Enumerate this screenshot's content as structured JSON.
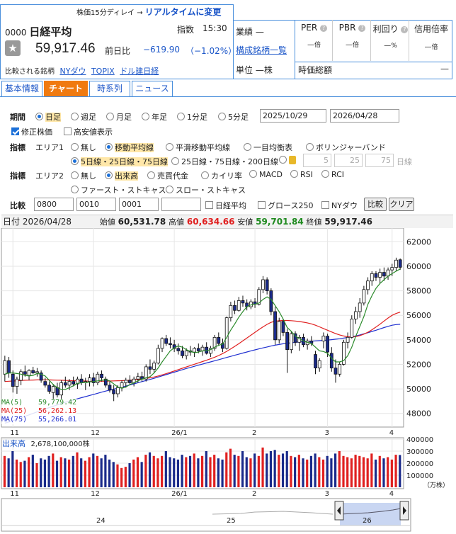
{
  "quote": {
    "delay_note": "株価15分ディレイ →",
    "realtime_link": "リアルタイムに変更",
    "code": "0000",
    "name": "日経平均",
    "type_label": "指数",
    "time": "15:30",
    "price": "59,917.46",
    "change_label": "前日比",
    "change": "−619.90",
    "change_pct": "（−1.02%）",
    "compare_label": "比較される銘柄",
    "compare_links": [
      "NYダウ",
      "TOPIX",
      "ドル建日経"
    ],
    "sector_label": "業績",
    "sector_value": "—",
    "constituents_link": "構成銘柄一覧",
    "unit_label": "単位",
    "unit_value": "—株",
    "metrics": [
      {
        "label": "PER",
        "value": "—",
        "unit": "倍"
      },
      {
        "label": "PBR",
        "value": "—",
        "unit": "倍"
      },
      {
        "label": "利回り",
        "value": "—",
        "unit": "%"
      },
      {
        "label": "信用倍率",
        "value": "—",
        "unit": "倍"
      }
    ],
    "market_cap_label": "時価総額",
    "market_cap_value": "—"
  },
  "tabs": [
    "基本情報",
    "チャート",
    "時系列",
    "ニュース"
  ],
  "controls": {
    "period_label": "期間",
    "period_options": [
      "日足",
      "週足",
      "月足",
      "年足",
      "1分足",
      "5分足"
    ],
    "date_from": "2025/10/29",
    "date_to": "2026/04/28",
    "adjusted_label": "修正株価",
    "high_low_label": "高安値表示",
    "indicator_label": "指標",
    "area1_label": "エリア1",
    "area1_options": [
      "無し",
      "移動平均線",
      "平滑移動平均線",
      "一目均衡表",
      "ボリンジャーバンド"
    ],
    "ma_options": [
      "5日線・25日線・75日線",
      "25日線・75日線・200日線"
    ],
    "ma_custom": [
      "5",
      "25",
      "75"
    ],
    "ma_custom_unit": "日線",
    "area2_label": "エリア2",
    "area2_options": [
      "無し",
      "出来高",
      "売買代金",
      "カイリ率",
      "MACD",
      "RSI",
      "RCI",
      "ファースト・ストキャス",
      "スロー・ストキャス"
    ],
    "compare_label": "比較",
    "compare_codes": [
      "0800",
      "0010",
      "0001",
      ""
    ],
    "compare_checks": [
      "日経平均",
      "グロース250",
      "NYダウ"
    ],
    "compare_button": "比較",
    "clear_button": "クリア"
  },
  "ohlc_bar": {
    "date_label": "日付",
    "date": "2026/04/28",
    "open_label": "始値",
    "open": "60,531.78",
    "high_label": "高値",
    "high": "60,634.66",
    "low_label": "安値",
    "low": "59,701.84",
    "close_label": "終値",
    "close": "59,917.46"
  },
  "legend": [
    {
      "label": "MA(5)",
      "value": "59,779.42",
      "color": "#2a8a2a"
    },
    {
      "label": "MA(25)",
      "value": "56,262.13",
      "color": "#e02020"
    },
    {
      "label": "MA(75)",
      "value": "55,266.01",
      "color": "#2030d0"
    }
  ],
  "volume_label": "出来高",
  "volume_value": "2,678,100,000株",
  "volume_unit": "（万株）",
  "x_labels": [
    "11",
    "12",
    "26/1",
    "2",
    "3",
    "4"
  ],
  "nav_labels": [
    "24",
    "25",
    "26"
  ],
  "chart_data": {
    "type": "candlestick",
    "ylim": [
      47000,
      63000
    ],
    "yticks": [
      48000,
      50000,
      52000,
      54000,
      56000,
      58000,
      60000,
      62000
    ],
    "volume_ylim": [
      0,
      400000
    ],
    "volume_ticks": [
      100000,
      200000,
      300000,
      400000
    ],
    "candles": [
      {
        "o": 51200,
        "h": 52700,
        "l": 50600,
        "c": 52300
      },
      {
        "o": 52300,
        "h": 52600,
        "l": 50900,
        "c": 51300
      },
      {
        "o": 51200,
        "h": 51500,
        "l": 49700,
        "c": 50200
      },
      {
        "o": 50200,
        "h": 51000,
        "l": 49600,
        "c": 50800
      },
      {
        "o": 50700,
        "h": 51600,
        "l": 50300,
        "c": 51400
      },
      {
        "o": 51400,
        "h": 51900,
        "l": 51000,
        "c": 51200
      },
      {
        "o": 51100,
        "h": 51600,
        "l": 50700,
        "c": 51500
      },
      {
        "o": 51500,
        "h": 51800,
        "l": 51200,
        "c": 51300
      },
      {
        "o": 51300,
        "h": 51700,
        "l": 51000,
        "c": 51400
      },
      {
        "o": 51300,
        "h": 51500,
        "l": 50500,
        "c": 50700
      },
      {
        "o": 50600,
        "h": 50900,
        "l": 50100,
        "c": 50300
      },
      {
        "o": 50300,
        "h": 50600,
        "l": 49600,
        "c": 49800
      },
      {
        "o": 49700,
        "h": 50400,
        "l": 48900,
        "c": 50200
      },
      {
        "o": 50100,
        "h": 50500,
        "l": 49300,
        "c": 49500
      },
      {
        "o": 49500,
        "h": 50700,
        "l": 49100,
        "c": 50500
      },
      {
        "o": 50500,
        "h": 51000,
        "l": 50100,
        "c": 50300
      },
      {
        "o": 50300,
        "h": 50800,
        "l": 49900,
        "c": 50600
      },
      {
        "o": 50600,
        "h": 51000,
        "l": 50200,
        "c": 50400
      },
      {
        "o": 50400,
        "h": 51000,
        "l": 50000,
        "c": 50800
      },
      {
        "o": 50800,
        "h": 51200,
        "l": 50300,
        "c": 50500
      },
      {
        "o": 50500,
        "h": 50900,
        "l": 49900,
        "c": 50600
      },
      {
        "o": 50600,
        "h": 51200,
        "l": 50200,
        "c": 50900
      },
      {
        "o": 50900,
        "h": 51300,
        "l": 50200,
        "c": 50500
      },
      {
        "o": 50500,
        "h": 51400,
        "l": 50300,
        "c": 51200
      },
      {
        "o": 51200,
        "h": 51500,
        "l": 50600,
        "c": 50900
      },
      {
        "o": 50800,
        "h": 51000,
        "l": 50100,
        "c": 50300
      },
      {
        "o": 50300,
        "h": 50600,
        "l": 49700,
        "c": 49900
      },
      {
        "o": 49900,
        "h": 50300,
        "l": 49000,
        "c": 49600
      },
      {
        "o": 49600,
        "h": 50300,
        "l": 49300,
        "c": 50100
      },
      {
        "o": 50100,
        "h": 50700,
        "l": 49800,
        "c": 50500
      },
      {
        "o": 50500,
        "h": 50900,
        "l": 50100,
        "c": 50700
      },
      {
        "o": 50700,
        "h": 51100,
        "l": 50300,
        "c": 50500
      },
      {
        "o": 50500,
        "h": 51000,
        "l": 50200,
        "c": 50800
      },
      {
        "o": 50800,
        "h": 51300,
        "l": 50500,
        "c": 51000
      },
      {
        "o": 51000,
        "h": 51400,
        "l": 50600,
        "c": 50800
      },
      {
        "o": 50800,
        "h": 52000,
        "l": 50600,
        "c": 51800
      },
      {
        "o": 51800,
        "h": 52400,
        "l": 51200,
        "c": 51600
      },
      {
        "o": 51600,
        "h": 52300,
        "l": 51300,
        "c": 52100
      },
      {
        "o": 52100,
        "h": 53600,
        "l": 52000,
        "c": 53300
      },
      {
        "o": 53300,
        "h": 54200,
        "l": 53000,
        "c": 54100
      },
      {
        "o": 54100,
        "h": 54400,
        "l": 53500,
        "c": 53700
      },
      {
        "o": 53700,
        "h": 54200,
        "l": 53300,
        "c": 53600
      },
      {
        "o": 53600,
        "h": 54000,
        "l": 53000,
        "c": 53300
      },
      {
        "o": 53300,
        "h": 53700,
        "l": 52800,
        "c": 53100
      },
      {
        "o": 53100,
        "h": 53500,
        "l": 52500,
        "c": 52700
      },
      {
        "o": 52700,
        "h": 53300,
        "l": 52400,
        "c": 53100
      },
      {
        "o": 53100,
        "h": 53500,
        "l": 52700,
        "c": 53000
      },
      {
        "o": 53000,
        "h": 53400,
        "l": 52600,
        "c": 53300
      },
      {
        "o": 53300,
        "h": 53700,
        "l": 52900,
        "c": 53100
      },
      {
        "o": 53100,
        "h": 53600,
        "l": 52700,
        "c": 53400
      },
      {
        "o": 53400,
        "h": 53800,
        "l": 52800,
        "c": 52900
      },
      {
        "o": 52900,
        "h": 53500,
        "l": 52600,
        "c": 53300
      },
      {
        "o": 53300,
        "h": 54400,
        "l": 53100,
        "c": 54200
      },
      {
        "o": 54200,
        "h": 54600,
        "l": 53500,
        "c": 53700
      },
      {
        "o": 53700,
        "h": 54100,
        "l": 53000,
        "c": 53300
      },
      {
        "o": 53300,
        "h": 55900,
        "l": 53200,
        "c": 55800
      },
      {
        "o": 55800,
        "h": 57100,
        "l": 55500,
        "c": 56800
      },
      {
        "o": 56800,
        "h": 57200,
        "l": 56100,
        "c": 56400
      },
      {
        "o": 56400,
        "h": 57500,
        "l": 56300,
        "c": 57200
      },
      {
        "o": 57200,
        "h": 57600,
        "l": 56700,
        "c": 57000
      },
      {
        "o": 57000,
        "h": 57300,
        "l": 56400,
        "c": 56700
      },
      {
        "o": 56700,
        "h": 57300,
        "l": 56500,
        "c": 57100
      },
      {
        "o": 57100,
        "h": 57400,
        "l": 56600,
        "c": 56900
      },
      {
        "o": 56900,
        "h": 58300,
        "l": 56800,
        "c": 58100
      },
      {
        "o": 58100,
        "h": 59200,
        "l": 57800,
        "c": 58900
      },
      {
        "o": 58900,
        "h": 59100,
        "l": 57700,
        "c": 58000
      },
      {
        "o": 58000,
        "h": 58200,
        "l": 56000,
        "c": 56300
      },
      {
        "o": 56300,
        "h": 56700,
        "l": 53600,
        "c": 54000
      },
      {
        "o": 54000,
        "h": 55800,
        "l": 53700,
        "c": 55500
      },
      {
        "o": 55500,
        "h": 55700,
        "l": 54300,
        "c": 54600
      },
      {
        "o": 54600,
        "h": 54900,
        "l": 51300,
        "c": 53200
      },
      {
        "o": 53200,
        "h": 54700,
        "l": 52900,
        "c": 54500
      },
      {
        "o": 54500,
        "h": 54700,
        "l": 53500,
        "c": 53800
      },
      {
        "o": 53800,
        "h": 54400,
        "l": 53100,
        "c": 54200
      },
      {
        "o": 54200,
        "h": 54500,
        "l": 53400,
        "c": 53600
      },
      {
        "o": 53600,
        "h": 54100,
        "l": 53200,
        "c": 53900
      },
      {
        "o": 53900,
        "h": 54300,
        "l": 53500,
        "c": 53700
      },
      {
        "o": 52800,
        "h": 53100,
        "l": 51200,
        "c": 51700
      },
      {
        "o": 51700,
        "h": 52500,
        "l": 51400,
        "c": 52300
      },
      {
        "o": 53900,
        "h": 54600,
        "l": 53300,
        "c": 54300
      },
      {
        "o": 54300,
        "h": 54500,
        "l": 52600,
        "c": 53000
      },
      {
        "o": 52900,
        "h": 53400,
        "l": 51400,
        "c": 51700
      },
      {
        "o": 51700,
        "h": 52400,
        "l": 50500,
        "c": 51200
      },
      {
        "o": 51200,
        "h": 52200,
        "l": 51000,
        "c": 52000
      },
      {
        "o": 52000,
        "h": 54000,
        "l": 51900,
        "c": 53800
      },
      {
        "o": 53800,
        "h": 54600,
        "l": 53300,
        "c": 54200
      },
      {
        "o": 54200,
        "h": 56000,
        "l": 54100,
        "c": 55700
      },
      {
        "o": 55700,
        "h": 56700,
        "l": 55300,
        "c": 56300
      },
      {
        "o": 56300,
        "h": 57400,
        "l": 55800,
        "c": 57000
      },
      {
        "o": 57000,
        "h": 58400,
        "l": 56800,
        "c": 58100
      },
      {
        "o": 58100,
        "h": 59100,
        "l": 57700,
        "c": 58800
      },
      {
        "o": 58800,
        "h": 59600,
        "l": 58400,
        "c": 59400
      },
      {
        "o": 59400,
        "h": 59600,
        "l": 58800,
        "c": 59100
      },
      {
        "o": 59100,
        "h": 59800,
        "l": 58600,
        "c": 59500
      },
      {
        "o": 59500,
        "h": 59900,
        "l": 58800,
        "c": 59200
      },
      {
        "o": 59200,
        "h": 59900,
        "l": 58900,
        "c": 59700
      },
      {
        "o": 59700,
        "h": 60200,
        "l": 59200,
        "c": 59900
      },
      {
        "o": 59900,
        "h": 60700,
        "l": 59600,
        "c": 60500
      },
      {
        "o": 60530,
        "h": 60635,
        "l": 59700,
        "c": 59917
      }
    ],
    "volumes": [
      260000,
      240000,
      300000,
      230000,
      210000,
      220000,
      250000,
      270000,
      200000,
      240000,
      230000,
      260000,
      280000,
      220000,
      250000,
      240000,
      230000,
      260000,
      290000,
      240000,
      220000,
      250000,
      280000,
      260000,
      240000,
      270000,
      230000,
      210000,
      190000,
      160000,
      170000,
      200000,
      230000,
      250000,
      210000,
      270000,
      290000,
      260000,
      240000,
      260000,
      300000,
      250000,
      240000,
      230000,
      270000,
      250000,
      260000,
      280000,
      240000,
      260000,
      300000,
      250000,
      270000,
      240000,
      230000,
      290000,
      320000,
      270000,
      260000,
      300000,
      250000,
      240000,
      280000,
      260000,
      330000,
      280000,
      300000,
      310000,
      270000,
      280000,
      300000,
      260000,
      250000,
      270000,
      240000,
      230000,
      260000,
      280000,
      250000,
      230000,
      260000,
      240000,
      280000,
      300000,
      260000,
      250000,
      240000,
      270000,
      260000,
      250000,
      240000,
      280000,
      230000,
      260000,
      240000,
      250000,
      230000,
      270000,
      268000
    ],
    "ma5": [
      51200,
      51300,
      51300,
      51250,
      51200,
      51100,
      51050,
      51100,
      51250,
      51200,
      51050,
      50700,
      50350,
      50100,
      49950,
      49950,
      50100,
      50250,
      50450,
      50500,
      50500,
      50550,
      50600,
      50650,
      50700,
      50750,
      50650,
      50400,
      50150,
      50050,
      50150,
      50350,
      50500,
      50650,
      50800,
      50900,
      51000,
      51300,
      51700,
      52200,
      52650,
      53100,
      53350,
      53500,
      53400,
      53200,
      53050,
      52950,
      53000,
      53100,
      53100,
      53200,
      53400,
      53550,
      53650,
      54200,
      54800,
      55300,
      55850,
      56300,
      56700,
      56850,
      56900,
      57000,
      57300,
      57500,
      57300,
      56800,
      56300,
      55700,
      55000,
      54700,
      54300,
      54100,
      53900,
      53800,
      53700,
      53400,
      53100,
      53050,
      52900,
      52500,
      52200,
      52200,
      52300,
      52700,
      53400,
      54300,
      55100,
      55900,
      56900,
      57600,
      58200,
      58600,
      58900,
      59200,
      59400,
      59600,
      59779
    ],
    "ma25": [
      50600,
      50620,
      50640,
      50660,
      50680,
      50700,
      50710,
      50720,
      50730,
      50740,
      50740,
      50730,
      50720,
      50710,
      50700,
      50690,
      50680,
      50670,
      50660,
      50650,
      50640,
      50630,
      50620,
      50620,
      50620,
      50630,
      50640,
      50650,
      50660,
      50670,
      50690,
      50710,
      50730,
      50760,
      50800,
      50850,
      50900,
      50970,
      51050,
      51140,
      51240,
      51350,
      51460,
      51570,
      51680,
      51790,
      51900,
      52010,
      52120,
      52230,
      52340,
      52450,
      52580,
      52720,
      52880,
      53060,
      53260,
      53470,
      53690,
      53920,
      54150,
      54380,
      54610,
      54840,
      55060,
      55260,
      55420,
      55520,
      55560,
      55580,
      55580,
      55560,
      55530,
      55490,
      55440,
      55380,
      55300,
      55190,
      55060,
      54920,
      54780,
      54640,
      54510,
      54400,
      54310,
      54250,
      54230,
      54260,
      54340,
      54460,
      54620,
      54820,
      55040,
      55280,
      55530,
      55780,
      56000,
      56150,
      56262
    ],
    "ma75": [
      47200,
      47300,
      47410,
      47520,
      47640,
      47760,
      47880,
      48000,
      48120,
      48240,
      48360,
      48470,
      48580,
      48690,
      48800,
      48900,
      49000,
      49100,
      49190,
      49280,
      49370,
      49460,
      49550,
      49640,
      49730,
      49820,
      49900,
      49980,
      50060,
      50140,
      50230,
      50320,
      50410,
      50500,
      50590,
      50680,
      50770,
      50860,
      50960,
      51060,
      51160,
      51260,
      51360,
      51460,
      51560,
      51660,
      51750,
      51840,
      51930,
      52020,
      52110,
      52200,
      52290,
      52380,
      52470,
      52560,
      52650,
      52740,
      52830,
      52920,
      53010,
      53100,
      53180,
      53260,
      53340,
      53420,
      53490,
      53560,
      53620,
      53680,
      53720,
      53760,
      53790,
      53820,
      53850,
      53870,
      53890,
      53910,
      53930,
      53950,
      53980,
      54010,
      54050,
      54090,
      54140,
      54190,
      54250,
      54320,
      54400,
      54490,
      54580,
      54680,
      54780,
      54890,
      55000,
      55100,
      55190,
      55240,
      55266
    ]
  }
}
